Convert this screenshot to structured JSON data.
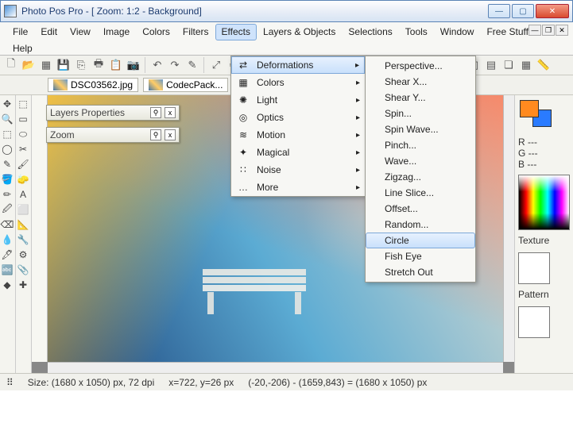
{
  "window": {
    "title": "Photo Pos Pro - [ Zoom: 1:2 - Background]",
    "subtitle": "]"
  },
  "menubar": {
    "items": [
      "File",
      "Edit",
      "View",
      "Image",
      "Colors",
      "Filters",
      "Effects",
      "Layers & Objects",
      "Selections",
      "Tools",
      "Window",
      "Free Stuff"
    ],
    "help": "Help",
    "open_index": 6
  },
  "doc_tabs": [
    {
      "label": "DSC03562.jpg"
    },
    {
      "label": "CodecPack..."
    }
  ],
  "float_panels": {
    "layers": "Layers Properties",
    "zoom": "Zoom"
  },
  "effects_menu": {
    "items": [
      {
        "label": "Deformations",
        "icon": "⇄"
      },
      {
        "label": "Colors",
        "icon": "▦"
      },
      {
        "label": "Light",
        "icon": "✺"
      },
      {
        "label": "Optics",
        "icon": "◎"
      },
      {
        "label": "Motion",
        "icon": "≋"
      },
      {
        "label": "Magical",
        "icon": "✦"
      },
      {
        "label": "Noise",
        "icon": "∷"
      },
      {
        "label": "More",
        "icon": "…"
      }
    ],
    "highlight_index": 0
  },
  "deform_menu": {
    "items": [
      "Perspective...",
      "Shear X...",
      "Shear Y...",
      "Spin...",
      "Spin Wave...",
      "Pinch...",
      "Wave...",
      "Zigzag...",
      "Line Slice...",
      "Offset...",
      "Random...",
      "Circle",
      "Fish Eye",
      "Stretch Out"
    ],
    "highlight_index": 11
  },
  "side": {
    "rgb_r": "R ---",
    "rgb_g": "G ---",
    "rgb_b": "B ---",
    "texture_label": "Texture",
    "pattern_label": "Pattern"
  },
  "status": {
    "size": "Size: (1680 x 1050) px, 72 dpi",
    "cursor": "x=722, y=26 px",
    "selection": "(-20,-206) - (1659,843) = (1680 x 1050) px"
  },
  "toolbar_icons": [
    "🗋",
    "📂",
    "▦",
    "💾",
    "⎘",
    "🖶",
    "📋",
    "📷",
    "↶",
    "↷",
    "✎",
    "⤢",
    "⇋",
    "⇵",
    "⬒",
    "↔",
    "↕",
    "▭",
    "◧",
    "◨",
    "⬚",
    "⧉",
    "📊",
    "◐",
    "⬛",
    "◧",
    "▤",
    "❏",
    "▦",
    "📏"
  ]
}
